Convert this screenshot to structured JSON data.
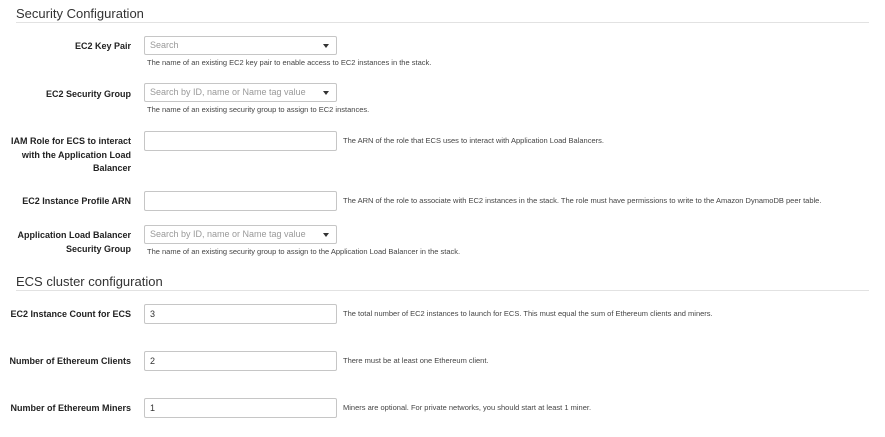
{
  "sections": {
    "security": {
      "title": "Security Configuration",
      "fields": {
        "key_pair": {
          "label": "EC2 Key Pair",
          "placeholder": "Search",
          "help": "The name of an existing EC2 key pair to enable access to EC2 instances in the stack."
        },
        "security_group": {
          "label": "EC2 Security Group",
          "placeholder": "Search by ID, name or Name tag value",
          "help": "The name of an existing security group to assign to EC2 instances."
        },
        "iam_role": {
          "label": "IAM Role for ECS to interact with the Application Load Balancer",
          "value": "",
          "help": "The ARN of the role that ECS uses to interact with Application Load Balancers."
        },
        "instance_profile": {
          "label": "EC2 Instance Profile ARN",
          "value": "",
          "help": "The ARN of the role to associate with EC2 instances in the stack. The role must have permissions to write to the Amazon DynamoDB peer table."
        },
        "alb_security_group": {
          "label": "Application Load Balancer Security Group",
          "placeholder": "Search by ID, name or Name tag value",
          "help": "The name of an existing security group to assign to the Application Load Balancer in the stack."
        }
      }
    },
    "ecs": {
      "title": "ECS cluster configuration",
      "fields": {
        "instance_count": {
          "label": "EC2 Instance Count for ECS",
          "value": "3",
          "help": "The total number of EC2 instances to launch for ECS. This must equal the sum of Ethereum clients and miners."
        },
        "eth_clients": {
          "label": "Number of Ethereum Clients",
          "value": "2",
          "help": "There must be at least one Ethereum client."
        },
        "eth_miners": {
          "label": "Number of Ethereum Miners",
          "value": "1",
          "help": "Miners are optional. For private networks, you should start at least 1 miner."
        }
      }
    }
  }
}
